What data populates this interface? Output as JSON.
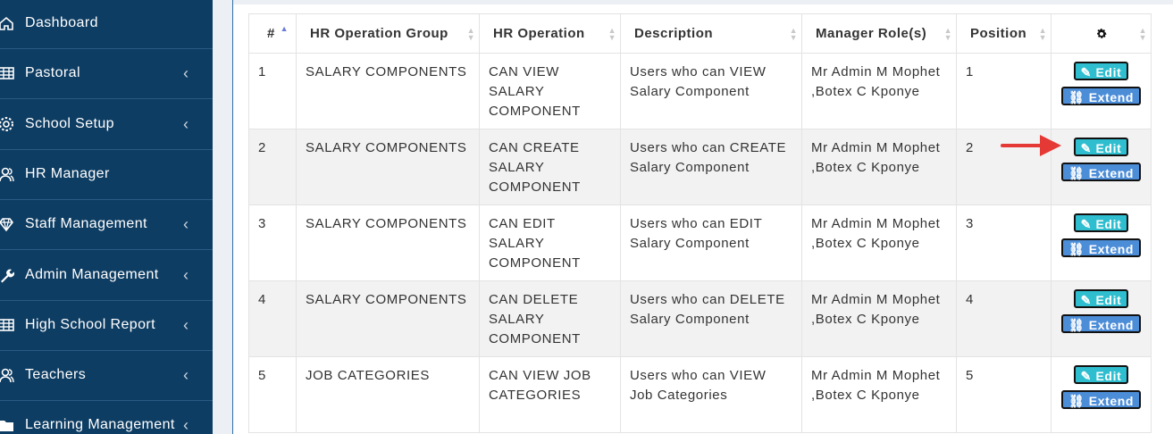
{
  "sidebar": {
    "items": [
      {
        "label": "Dashboard",
        "icon": "home-icon",
        "has_chevron": false
      },
      {
        "label": "Pastoral",
        "icon": "table-icon",
        "has_chevron": true
      },
      {
        "label": "School Setup",
        "icon": "gear-icon",
        "has_chevron": true
      },
      {
        "label": "HR Manager",
        "icon": "users-icon",
        "has_chevron": false
      },
      {
        "label": "Staff Management",
        "icon": "diamond-icon",
        "has_chevron": true
      },
      {
        "label": "Admin Management",
        "icon": "wrench-icon",
        "has_chevron": true
      },
      {
        "label": "High School Report",
        "icon": "table-icon",
        "has_chevron": true
      },
      {
        "label": "Teachers",
        "icon": "users-icon",
        "has_chevron": true
      },
      {
        "label": "Learning Management",
        "icon": "folder-icon",
        "has_chevron": true
      }
    ],
    "chevron": "‹"
  },
  "table": {
    "headers": {
      "num": "#",
      "group": "HR Operation Group",
      "operation": "HR Operation",
      "description": "Description",
      "managers": "Manager Role(s)",
      "position": "Position",
      "actions_icon": "gear-icon"
    },
    "rows": [
      {
        "num": "1",
        "group": "SALARY COMPONENTS",
        "operation": "CAN VIEW SALARY COMPONENT",
        "description": "Users who can VIEW Salary Component",
        "managers": "Mr Admin M Mophet ,Botex C Kponye",
        "position": "1"
      },
      {
        "num": "2",
        "group": "SALARY COMPONENTS",
        "operation": "CAN CREATE SALARY COMPONENT",
        "description": "Users who can CREATE Salary Component",
        "managers": "Mr Admin M Mophet ,Botex C Kponye",
        "position": "2"
      },
      {
        "num": "3",
        "group": "SALARY COMPONENTS",
        "operation": "CAN EDIT SALARY COMPONENT",
        "description": "Users who can EDIT Salary Component",
        "managers": "Mr Admin M Mophet ,Botex C Kponye",
        "position": "3"
      },
      {
        "num": "4",
        "group": "SALARY COMPONENTS",
        "operation": "CAN DELETE SALARY COMPONENT",
        "description": "Users who can DELETE Salary Component",
        "managers": "Mr Admin M Mophet ,Botex C Kponye",
        "position": "4"
      },
      {
        "num": "5",
        "group": "JOB CATEGORIES",
        "operation": "CAN VIEW JOB CATEGORIES",
        "description": "Users who can VIEW Job Categories",
        "managers": "Mr Admin M Mophet ,Botex C Kponye",
        "position": "5"
      }
    ],
    "edit_label": "Edit",
    "extend_label": "Extend"
  },
  "colors": {
    "sidebar_bg": "#0e3d63",
    "edit_button": "#2fbecf",
    "extend_button": "#4c8dd8",
    "annotation_arrow": "#e53935"
  }
}
